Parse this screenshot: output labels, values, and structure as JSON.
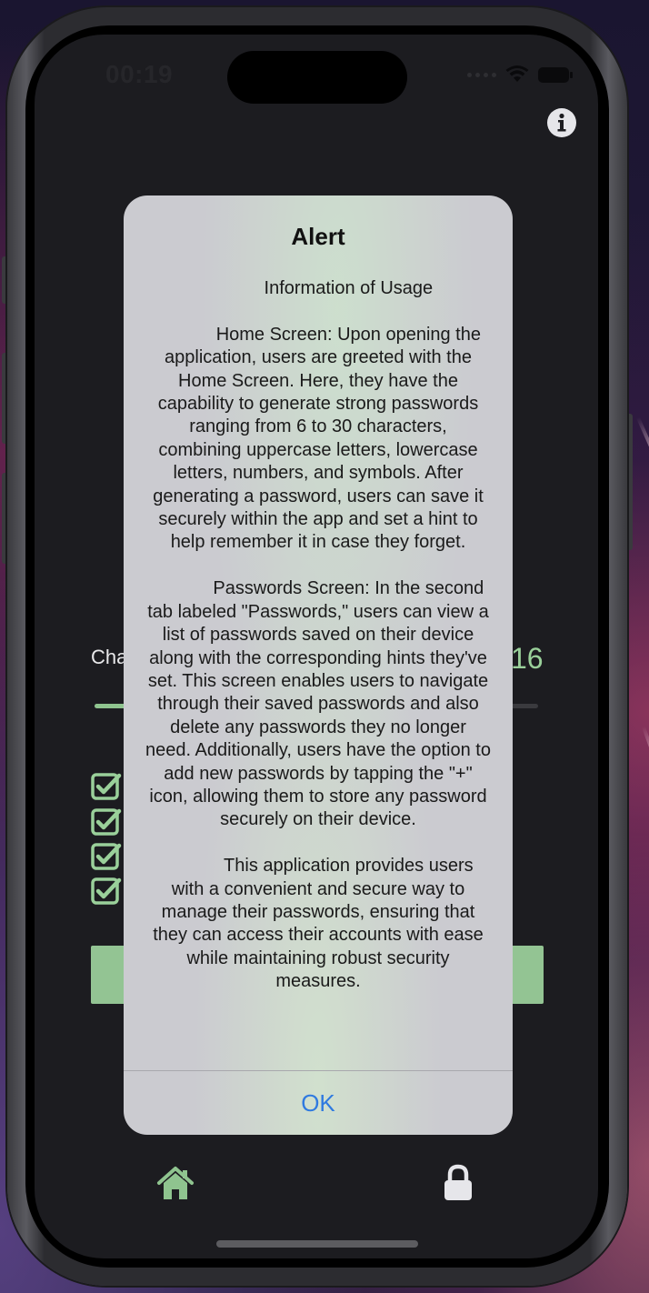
{
  "status_bar": {
    "time": "00:19",
    "wifi_icon": "wifi-icon",
    "battery_icon": "battery-icon"
  },
  "header": {
    "info_icon": "info-circle-icon"
  },
  "home": {
    "characters_label": "Characters",
    "character_count": "16",
    "slider": {
      "min": 6,
      "max": 30,
      "value": 16
    },
    "checkboxes": [
      {
        "checked": true
      },
      {
        "checked": true
      },
      {
        "checked": true
      },
      {
        "checked": true
      }
    ],
    "generate_button_color": "#93c493"
  },
  "tab_bar": {
    "home_icon": "house-icon",
    "passwords_icon": "lock-icon",
    "active_color": "#8fc48f"
  },
  "alert": {
    "title": "Alert",
    "message": "            Information of Usage\n\n            Home Screen: Upon opening the application, users are greeted with the Home Screen. Here, they have the capability to generate strong passwords ranging from 6 to 30 characters, combining uppercase letters, lowercase letters, numbers, and symbols. After generating a password, users can save it securely within the app and set a hint to help remember it in case they forget.\n\n            Passwords Screen: In the second tab labeled \"Passwords,\" users can view a list of passwords saved on their device along with the corresponding hints they've set. This screen enables users to navigate through their saved passwords and also delete any passwords they no longer need. Additionally, users have the option to add new passwords by tapping the \"+\" icon, allowing them to store any password securely on their device.\n\n            This application provides users with a convenient and secure way to manage their passwords, ensuring that they can access their accounts with ease while maintaining robust security measures.",
    "ok_label": "OK",
    "ok_color": "#2f7ae0"
  }
}
